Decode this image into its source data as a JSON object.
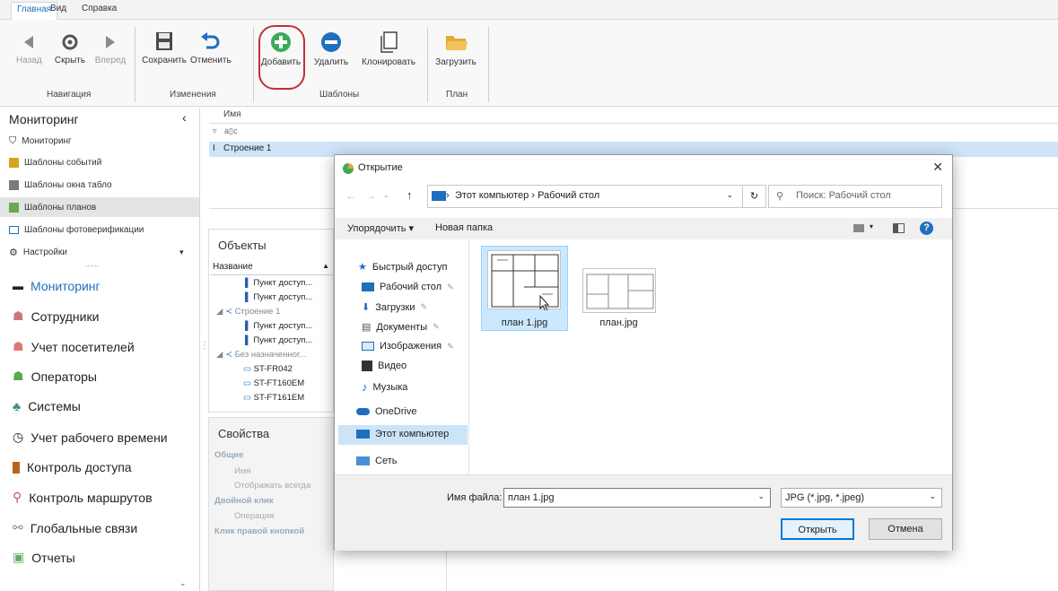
{
  "menu": {
    "home": "Главная",
    "view": "Вид",
    "help": "Справка"
  },
  "ribbon": {
    "back": "Назад",
    "hide": "Скрыть",
    "forward": "Вперед",
    "save": "Сохранить",
    "undo": "Отменить",
    "add": "Добавить",
    "delete": "Удалить",
    "clone": "Клонировать",
    "load": "Загрузить",
    "groups": {
      "navigation": "Навигация",
      "changes": "Изменения",
      "templates": "Шаблоны",
      "plan": "План"
    }
  },
  "sidebar": {
    "header": "Мониторинг",
    "items": [
      "Мониторинг",
      "Шаблоны событий",
      "Шаблоны окна табло",
      "Шаблоны планов",
      "Шаблоны фотоверификации",
      "Настройки"
    ],
    "dots": "......",
    "nav": [
      "Мониторинг",
      "Сотрудники",
      "Учет посетителей",
      "Операторы",
      "Системы",
      "Учет рабочего времени",
      "Контроль доступа",
      "Контроль маршрутов",
      "Глобальные связи",
      "Отчеты"
    ]
  },
  "grid": {
    "header": "Имя",
    "filter": "a▯c",
    "row": "Строение 1"
  },
  "objects": {
    "title": "Объекты",
    "col": "Название",
    "rows": [
      "Пункт доступ...",
      "Пункт доступ...",
      "Строение 1",
      "Пункт доступ...",
      "Пункт доступ...",
      "Без назначенног...",
      "ST-FR042",
      "ST-FT160EM",
      "ST-FT161EM"
    ]
  },
  "props": {
    "title": "Свойства",
    "rows": [
      "Общие",
      "Имя",
      "Отображать всегда",
      "Двойной клик",
      "Операция",
      "Клик правой кнопкой"
    ]
  },
  "dialog": {
    "title": "Открытие",
    "path": [
      "Этот компьютер",
      "Рабочий стол"
    ],
    "search_placeholder": "Поиск: Рабочий стол",
    "organize": "Упорядочить ▾",
    "new_folder": "Новая папка",
    "tree": [
      "Быстрый доступ",
      "Рабочий стол",
      "Загрузки",
      "Документы",
      "Изображения",
      "Видео",
      "Музыка",
      "OneDrive",
      "Этот компьютер",
      "Сеть"
    ],
    "files": [
      "план 1.jpg",
      "план.jpg"
    ],
    "filename_label": "Имя файла:",
    "filename_value": "план 1.jpg",
    "filetype": "JPG (*.jpg, *.jpeg)",
    "open": "Открыть",
    "cancel": "Отмена"
  },
  "colors": {
    "accent": "#1f6fbf",
    "highlight": "#cfe4f7",
    "circle": "#c0303a"
  }
}
